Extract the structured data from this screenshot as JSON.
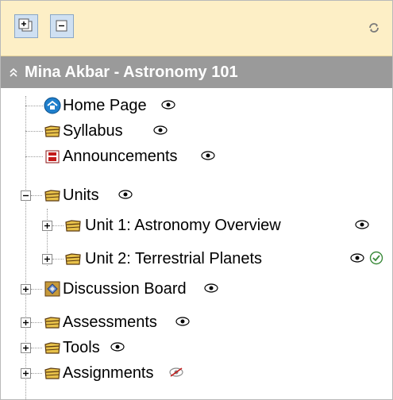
{
  "toolbar": {
    "expand_all_icon": "expand-all-icon",
    "collapse_all_icon": "collapse-all-icon",
    "refresh_icon": "refresh-icon"
  },
  "course": {
    "title": "Mina Akbar - Astronomy 101",
    "chevron_icon": "double-chevron-up-icon"
  },
  "tree": {
    "items": [
      {
        "label": "Home Page",
        "icon": "home-page-icon",
        "status": "visible-eye-icon"
      },
      {
        "label": "Syllabus",
        "icon": "folder-icon",
        "status": "visible-eye-icon"
      },
      {
        "label": "Announcements",
        "icon": "announcements-icon",
        "status": "visible-eye-icon"
      },
      {
        "label": "Units",
        "icon": "folder-icon",
        "status": "visible-eye-icon",
        "expanded": true,
        "children": [
          {
            "label": "Unit 1: Astronomy Overview",
            "icon": "folder-icon",
            "status": "visible-eye-icon"
          },
          {
            "label": "Unit 2: Terrestrial Planets",
            "icon": "folder-icon",
            "status": "visible-eye-icon",
            "extra": "checkmark-circle-icon"
          }
        ]
      },
      {
        "label": "Discussion Board",
        "icon": "discussion-board-icon",
        "status": "visible-eye-icon"
      },
      {
        "label": "Assessments",
        "icon": "folder-icon",
        "status": "visible-eye-icon"
      },
      {
        "label": "Tools",
        "icon": "folder-icon",
        "status": "visible-eye-icon"
      },
      {
        "label": "Assignments",
        "icon": "folder-icon",
        "status": "hidden-eye-icon"
      }
    ]
  },
  "colors": {
    "toolbar_bg": "#fdefc6",
    "header_bg": "#9a9a9a",
    "header_text": "#ffffff"
  }
}
